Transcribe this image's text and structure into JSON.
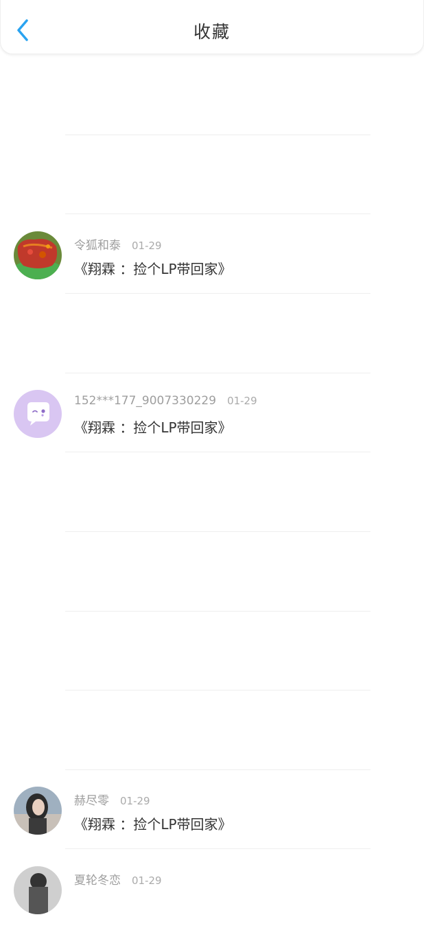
{
  "header": {
    "title": "收藏",
    "back_icon": "chevron-left-icon",
    "accent": "#2aa3f0"
  },
  "items": [
    {
      "user": "令狐和泰",
      "time": "01-29",
      "text": "《翔霖 ：捡个LP带回家》",
      "avatar": "food-photo"
    },
    {
      "user": "152***177_9007330229",
      "time": "01-29",
      "text": "《翔霖 ：捡个LP带回家》",
      "avatar": "chat-bubble-icon"
    },
    {
      "user": "赫尽零",
      "time": "01-29",
      "text": "《翔霖 ：捡个LP带回家》",
      "avatar": "person-photo"
    },
    {
      "user": "夏轮冬恋",
      "time": "01-29",
      "text": "",
      "avatar": "person-photo"
    }
  ]
}
